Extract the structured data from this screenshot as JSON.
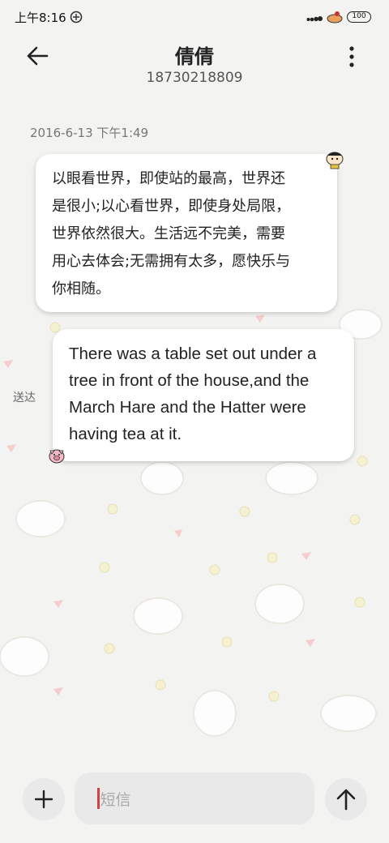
{
  "status_bar": {
    "time": "上午8:16",
    "battery": "100"
  },
  "header": {
    "contact_name": "倩倩",
    "contact_number": "18730218809"
  },
  "conversation": {
    "timestamp": "2016-6-13 下午1:49",
    "messages": [
      {
        "direction": "incoming",
        "lines": [
          "以眼看世界，即使站的最高，世界还",
          "是很小;以心看世界，即使身处局限，",
          "世界依然很大。生活远不完美，需要",
          "用心去体会;无需拥有太多，愿快乐与",
          "你相随。"
        ]
      },
      {
        "direction": "outgoing",
        "status": "送达",
        "lines": [
          "There was a table set out under a",
          "tree in front of the house,and the",
          "March Hare and the Hatter were",
          "having tea at it."
        ]
      }
    ]
  },
  "composer": {
    "placeholder": "短信"
  },
  "colors": {
    "background": "#f3f3f1",
    "bubble": "#ffffff",
    "caret": "#d64040"
  }
}
